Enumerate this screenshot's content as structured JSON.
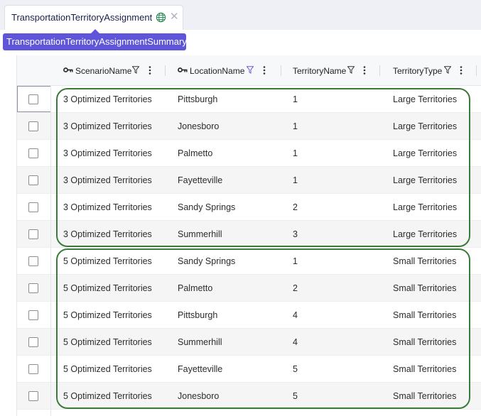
{
  "tab": {
    "title": "TransportationTerritoryAssignment",
    "icon": "globe-icon",
    "close_glyph": "✕"
  },
  "tooltip": {
    "text": "TransportationTerritoryAssignmentSummary"
  },
  "grid": {
    "columns": [
      {
        "label": "ScenarioName",
        "key": true,
        "filter_active": false
      },
      {
        "label": "LocationName",
        "key": true,
        "filter_active": true
      },
      {
        "label": "TerritoryName",
        "key": false,
        "filter_active": false
      },
      {
        "label": "TerritoryType",
        "key": false,
        "filter_active": false
      }
    ],
    "rows": [
      {
        "scenario": "3 Optimized Territories",
        "location": "Pittsburgh",
        "territory": "1",
        "type": "Large Territories"
      },
      {
        "scenario": "3 Optimized Territories",
        "location": "Jonesboro",
        "territory": "1",
        "type": "Large Territories"
      },
      {
        "scenario": "3 Optimized Territories",
        "location": "Palmetto",
        "territory": "1",
        "type": "Large Territories"
      },
      {
        "scenario": "3 Optimized Territories",
        "location": "Fayetteville",
        "territory": "1",
        "type": "Large Territories"
      },
      {
        "scenario": "3 Optimized Territories",
        "location": "Sandy Springs",
        "territory": "2",
        "type": "Large Territories"
      },
      {
        "scenario": "3 Optimized Territories",
        "location": "Summerhill",
        "territory": "3",
        "type": "Large Territories"
      },
      {
        "scenario": "5 Optimized Territories",
        "location": "Sandy Springs",
        "territory": "1",
        "type": "Small Territories"
      },
      {
        "scenario": "5 Optimized Territories",
        "location": "Palmetto",
        "territory": "2",
        "type": "Small Territories"
      },
      {
        "scenario": "5 Optimized Territories",
        "location": "Pittsburgh",
        "territory": "4",
        "type": "Small Territories"
      },
      {
        "scenario": "5 Optimized Territories",
        "location": "Summerhill",
        "territory": "4",
        "type": "Small Territories"
      },
      {
        "scenario": "5 Optimized Territories",
        "location": "Fayetteville",
        "territory": "5",
        "type": "Small Territories"
      },
      {
        "scenario": "5 Optimized Territories",
        "location": "Jonesboro",
        "territory": "5",
        "type": "Small Territories"
      }
    ]
  },
  "colors": {
    "tab_bg": "#ffffff",
    "topbar_bg": "#eef0f5",
    "tooltip_bg": "#5f55d8",
    "highlight_border": "#3c7a3a",
    "globe": "#2e8b57",
    "filter_active": "#6a5acd"
  }
}
